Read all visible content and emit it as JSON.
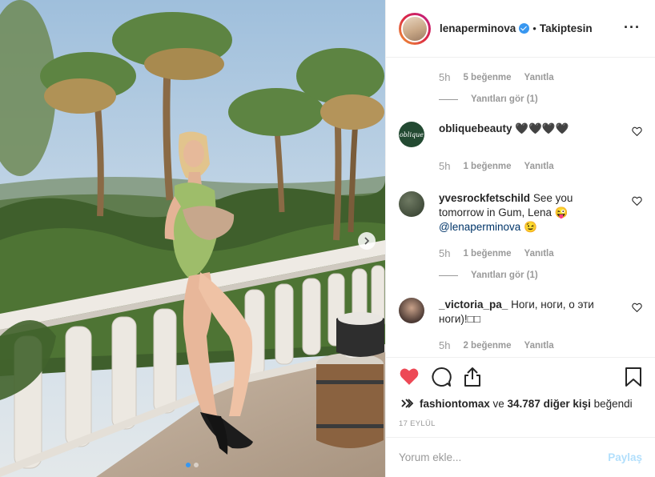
{
  "post": {
    "username": "lenaperminova",
    "separator": "•",
    "follow_status": "Takiptesin",
    "more_icon": "more-options-icon"
  },
  "comments": {
    "prev_meta": {
      "time": "5h",
      "likes": "5 beğenme",
      "reply": "Yanıtla"
    },
    "prev_view_replies": "Yanıtları gör (1)",
    "items": [
      {
        "username": "obliquebeauty",
        "text": "🖤🖤🖤🖤",
        "time": "5h",
        "likes": "1 beğenme",
        "reply": "Yanıtla",
        "avatar_label": "oblique"
      },
      {
        "username": "yvesrockfetschild",
        "text": "See you tomorrow in Gum, Lena 😜",
        "mention": "@lenaperminova",
        "text_after": " 😉",
        "time": "5h",
        "likes": "1 beğenme",
        "reply": "Yanıtla",
        "view_replies": "Yanıtları gör (1)"
      },
      {
        "username": "_victoria_pa_",
        "text": "Ноги, ноги, о эти ноги)!□□",
        "time": "5h",
        "likes": "2 beğenme",
        "reply": "Yanıtla"
      }
    ]
  },
  "actions": {
    "like_icon": "heart-filled-icon",
    "comment_icon": "comment-icon",
    "share_icon": "share-icon",
    "save_icon": "bookmark-icon",
    "like_color": "#ed4956"
  },
  "likes": {
    "liked_user": "fashiontomax",
    "connector": " ve ",
    "others": "34.787 diğer kişi",
    "suffix": " beğendi"
  },
  "date": "17 EYLÜL",
  "composer": {
    "placeholder": "Yorum ekle...",
    "post_label": "Paylaş"
  },
  "carousel": {
    "current": 1,
    "total": 2
  }
}
